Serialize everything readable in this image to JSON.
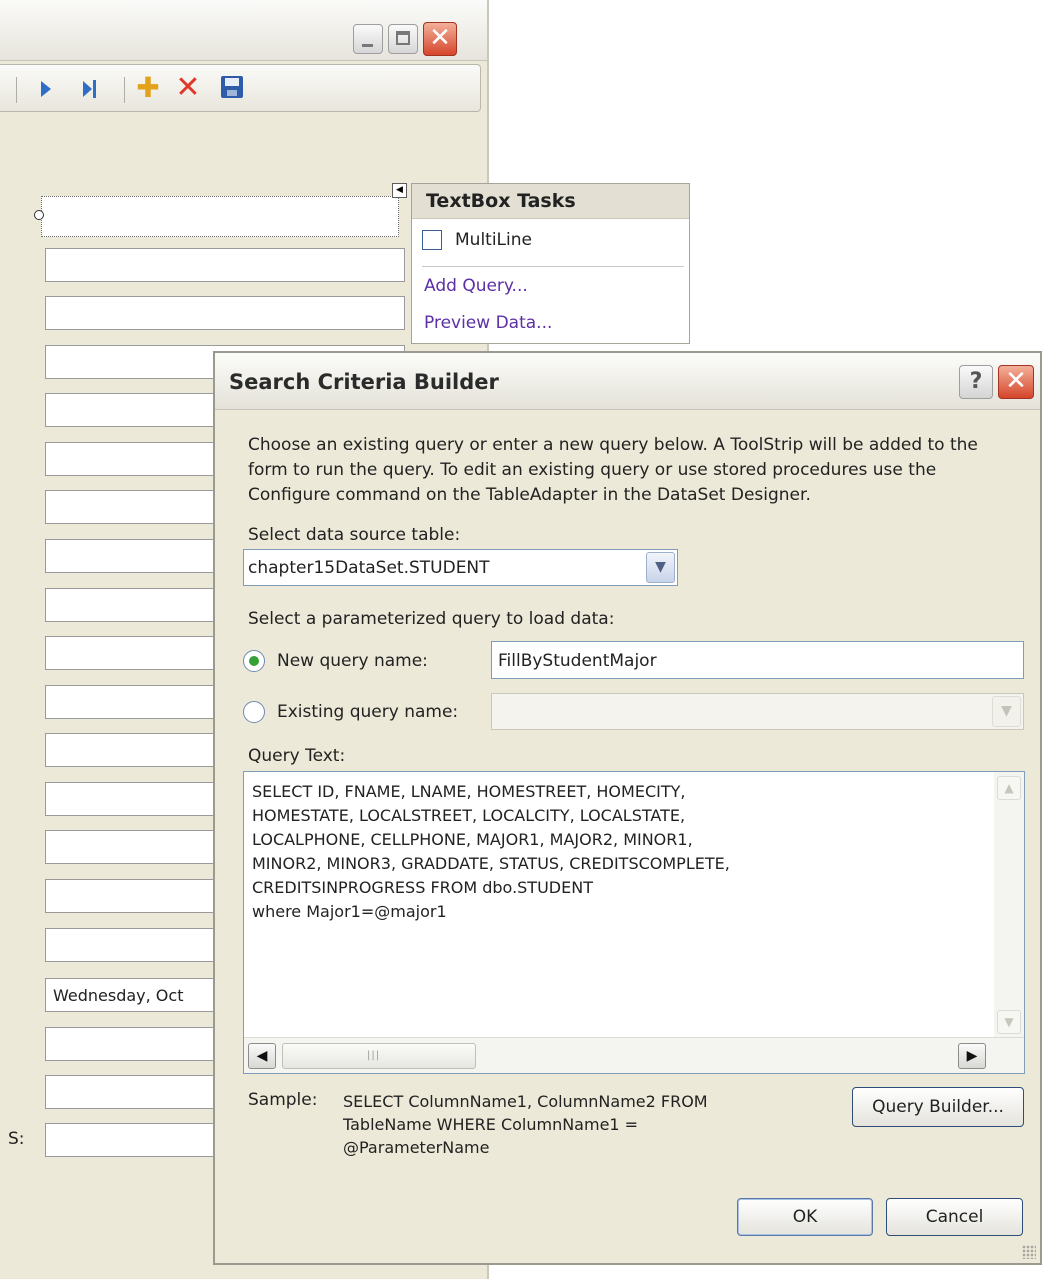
{
  "form": {
    "date_value": "Wednesday,  Oct",
    "partial_label": "S:",
    "colors": {
      "background": "#ece9d8",
      "close_red": "#d5452b"
    }
  },
  "toolbar": {
    "icons": [
      "move-next-icon",
      "move-last-icon",
      "add-new-icon",
      "delete-icon",
      "save-icon"
    ]
  },
  "smart_tag": {
    "title": "TextBox Tasks",
    "multiline_label": "MultiLine",
    "multiline_checked": false,
    "links": [
      "Add Query...",
      "Preview Data..."
    ],
    "link_color": "#5c2fa5"
  },
  "dialog": {
    "title": "Search Criteria Builder",
    "help_glyph": "?",
    "description": "Choose an existing query or enter a new query below. A ToolStrip will be added to the form to run the query. To edit an existing query or use stored procedures use the Configure command on the TableAdapter in the DataSet Designer.",
    "table_label": "Select data source table:",
    "table_value": "chapter15DataSet.STUDENT",
    "param_label": "Select a parameterized query to load data:",
    "new_query_label": "New query name:",
    "new_query_value": "FillByStudentMajor",
    "new_query_selected": true,
    "existing_query_label": "Existing query name:",
    "existing_query_value": "",
    "query_text_label": "Query Text:",
    "query_text": "SELECT ID, FNAME, LNAME, HOMESTREET, HOMECITY,\nHOMESTATE, LOCALSTREET, LOCALCITY, LOCALSTATE,\nLOCALPHONE, CELLPHONE, MAJOR1, MAJOR2, MINOR1,\nMINOR2, MINOR3, GRADDATE, STATUS, CREDITSCOMPLETE,\nCREDITSINPROGRESS FROM dbo.STUDENT\nwhere Major1=@major1",
    "sample_label": "Sample:",
    "sample_text": "SELECT ColumnName1, ColumnName2 FROM TableName WHERE ColumnName1 = @ParameterName",
    "query_builder_label": "Query Builder...",
    "ok_label": "OK",
    "cancel_label": "Cancel"
  }
}
